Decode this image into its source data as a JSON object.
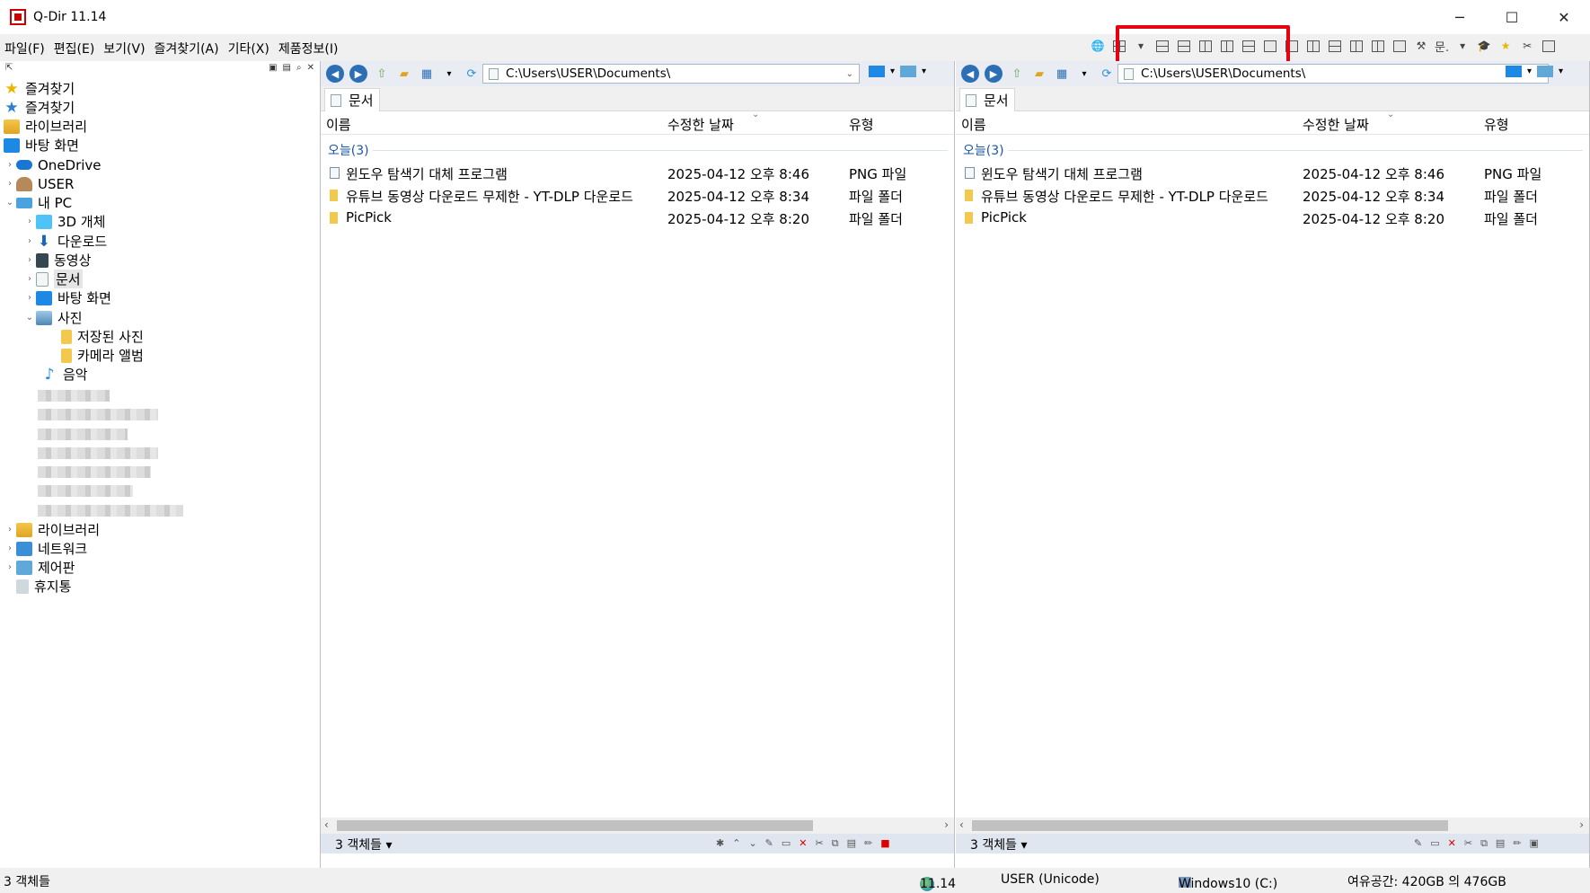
{
  "window": {
    "title": "Q-Dir 11.14",
    "minimize": "─",
    "maximize": "☐",
    "close": "✕"
  },
  "menu": [
    "파일(F)",
    "편집(E)",
    "보기(V)",
    "즐겨찾기(A)",
    "기타(X)",
    "제품정보(I)"
  ],
  "main_toolbar": {
    "doc_label": "문."
  },
  "tree": {
    "items": [
      {
        "label": "즐겨찾기",
        "icon": "star-icon"
      },
      {
        "label": "즐겨찾기",
        "icon": "star-blue-icon"
      },
      {
        "label": "라이브러리",
        "icon": "library-icon"
      },
      {
        "label": "바탕 화면",
        "icon": "desktop-icon"
      },
      {
        "label": "OneDrive",
        "icon": "cloud-icon"
      },
      {
        "label": "USER",
        "icon": "user-icon"
      },
      {
        "label": "내 PC",
        "icon": "pc-icon"
      },
      {
        "label": "3D 개체",
        "icon": "cube-icon"
      },
      {
        "label": "다운로드",
        "icon": "download-icon"
      },
      {
        "label": "동영상",
        "icon": "video-icon"
      },
      {
        "label": "문서",
        "icon": "document-icon"
      },
      {
        "label": "바탕 화면",
        "icon": "desktop-icon"
      },
      {
        "label": "사진",
        "icon": "pictures-icon"
      },
      {
        "label": "저장된 사진",
        "icon": "folder-icon"
      },
      {
        "label": "카메라 앨범",
        "icon": "folder-icon"
      },
      {
        "label": "음악",
        "icon": "music-icon"
      },
      {
        "label": "라이브러리",
        "icon": "library-icon"
      },
      {
        "label": "네트워크",
        "icon": "network-icon"
      },
      {
        "label": "제어판",
        "icon": "control-panel-icon"
      },
      {
        "label": "휴지통",
        "icon": "recycle-bin-icon"
      }
    ]
  },
  "left_pane": {
    "path": "C:\\Users\\USER\\Documents\\",
    "tab": "문서",
    "columns": {
      "name": "이름",
      "modified": "수정한 날짜",
      "type": "유형"
    },
    "group": "오늘(3)",
    "rows": [
      {
        "name": "윈도우 탐색기 대체 프로그램",
        "modified": "2025-04-12 오후 8:46",
        "type": "PNG 파일",
        "kind": "file"
      },
      {
        "name": "유튜브 동영상 다운로드 무제한 - YT-DLP 다운로드",
        "modified": "2025-04-12 오후 8:34",
        "type": "파일 폴더",
        "kind": "folder"
      },
      {
        "name": "PicPick",
        "modified": "2025-04-12 오후 8:20",
        "type": "파일 폴더",
        "kind": "folder"
      }
    ],
    "status": "3 객체들"
  },
  "right_pane": {
    "path": "C:\\Users\\USER\\Documents\\",
    "tab": "문서",
    "columns": {
      "name": "이름",
      "modified": "수정한 날짜",
      "type": "유형"
    },
    "group": "오늘(3)",
    "rows": [
      {
        "name": "윈도우 탐색기 대체 프로그램",
        "modified": "2025-04-12 오후 8:46",
        "type": "PNG 파일",
        "kind": "file"
      },
      {
        "name": "유튜브 동영상 다운로드 무제한 - YT-DLP 다운로드",
        "modified": "2025-04-12 오후 8:34",
        "type": "파일 폴더",
        "kind": "folder"
      },
      {
        "name": "PicPick",
        "modified": "2025-04-12 오후 8:20",
        "type": "파일 폴더",
        "kind": "folder"
      }
    ],
    "status": "3 객체들"
  },
  "statusbar": {
    "objects": "3 객체들",
    "version": "11.14",
    "user": "USER (Unicode)",
    "drive": "Windows10 (C:)",
    "free_space": "여유공간: 420GB 의 476GB"
  },
  "colors": {
    "highlight": "#e60012",
    "group_text": "#1a56a8"
  }
}
